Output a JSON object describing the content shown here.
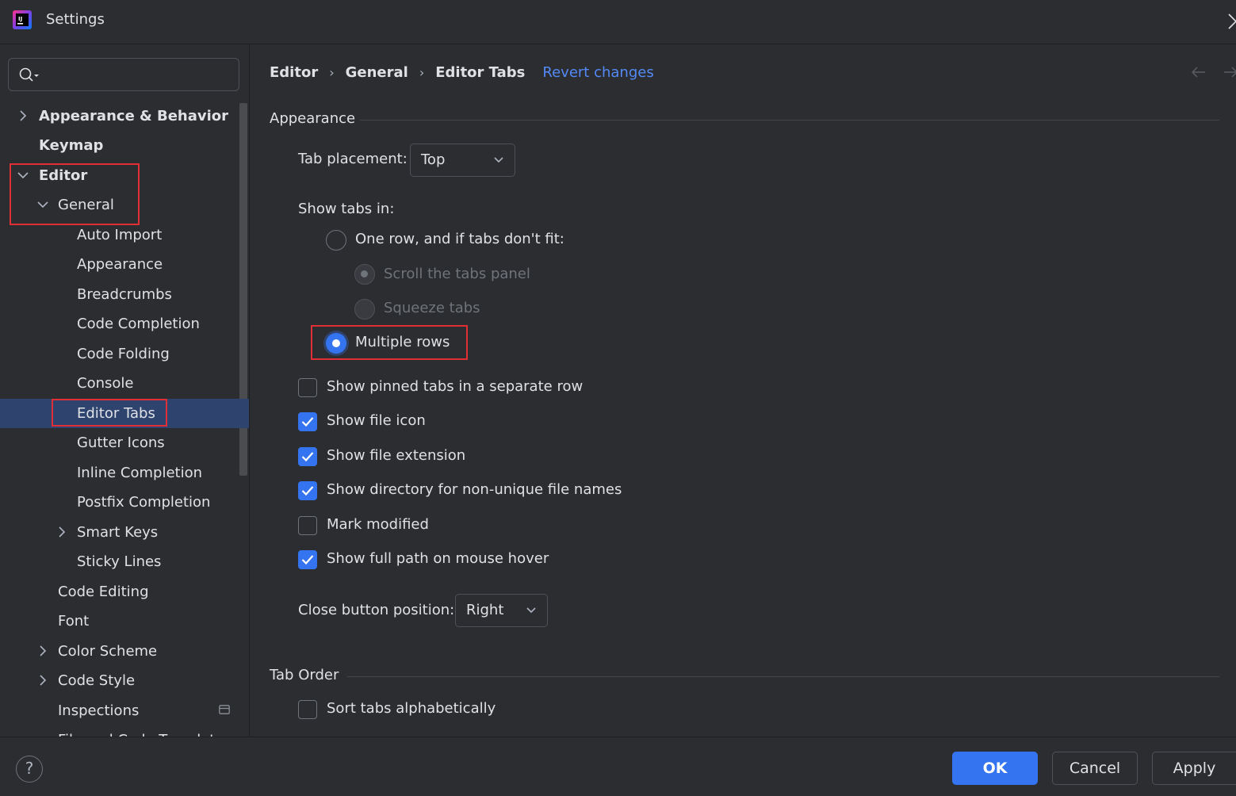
{
  "window": {
    "title": "Settings"
  },
  "sidebar": {
    "search_placeholder": "",
    "items": [
      {
        "label": "Appearance & Behavior"
      },
      {
        "label": "Keymap"
      },
      {
        "label": "Editor"
      },
      {
        "label": "General"
      },
      {
        "label": "Auto Import"
      },
      {
        "label": "Appearance"
      },
      {
        "label": "Breadcrumbs"
      },
      {
        "label": "Code Completion"
      },
      {
        "label": "Code Folding"
      },
      {
        "label": "Console"
      },
      {
        "label": "Editor Tabs"
      },
      {
        "label": "Gutter Icons"
      },
      {
        "label": "Inline Completion"
      },
      {
        "label": "Postfix Completion"
      },
      {
        "label": "Smart Keys"
      },
      {
        "label": "Sticky Lines"
      },
      {
        "label": "Code Editing"
      },
      {
        "label": "Font"
      },
      {
        "label": "Color Scheme"
      },
      {
        "label": "Code Style"
      },
      {
        "label": "Inspections"
      },
      {
        "label": "File and Code Templates"
      }
    ]
  },
  "breadcrumb": {
    "items": [
      "Editor",
      "General",
      "Editor Tabs"
    ],
    "revert_label": "Revert changes"
  },
  "sections": {
    "appearance_title": "Appearance",
    "tab_order_title": "Tab Order"
  },
  "settings": {
    "tab_placement_label": "Tab placement:",
    "tab_placement_value": "Top",
    "show_tabs_in_label": "Show tabs in:",
    "radios": [
      {
        "label": "One row, and if tabs don't fit:",
        "checked": false,
        "disabled": false
      },
      {
        "label": "Scroll the tabs panel",
        "checked": true,
        "disabled": true
      },
      {
        "label": "Squeeze tabs",
        "checked": false,
        "disabled": true
      },
      {
        "label": "Multiple rows",
        "checked": true,
        "disabled": false
      }
    ],
    "checkboxes": [
      {
        "label": "Show pinned tabs in a separate row",
        "checked": false
      },
      {
        "label": "Show file icon",
        "checked": true
      },
      {
        "label": "Show file extension",
        "checked": true
      },
      {
        "label": "Show directory for non-unique file names",
        "checked": true
      },
      {
        "label": "Mark modified",
        "checked": false
      },
      {
        "label": "Show full path on mouse hover",
        "checked": true
      }
    ],
    "close_button_label": "Close button position:",
    "close_button_value": "Right",
    "sort_alphabetically_label": "Sort tabs alphabetically",
    "sort_alphabetically_checked": false
  },
  "footer": {
    "help_label": "?",
    "ok_label": "OK",
    "cancel_label": "Cancel",
    "apply_label": "Apply"
  },
  "colors": {
    "background": "#2b2d30",
    "accent": "#3574f0",
    "selection": "#2e436e",
    "link": "#548af7",
    "highlight_box": "#e02f36"
  }
}
